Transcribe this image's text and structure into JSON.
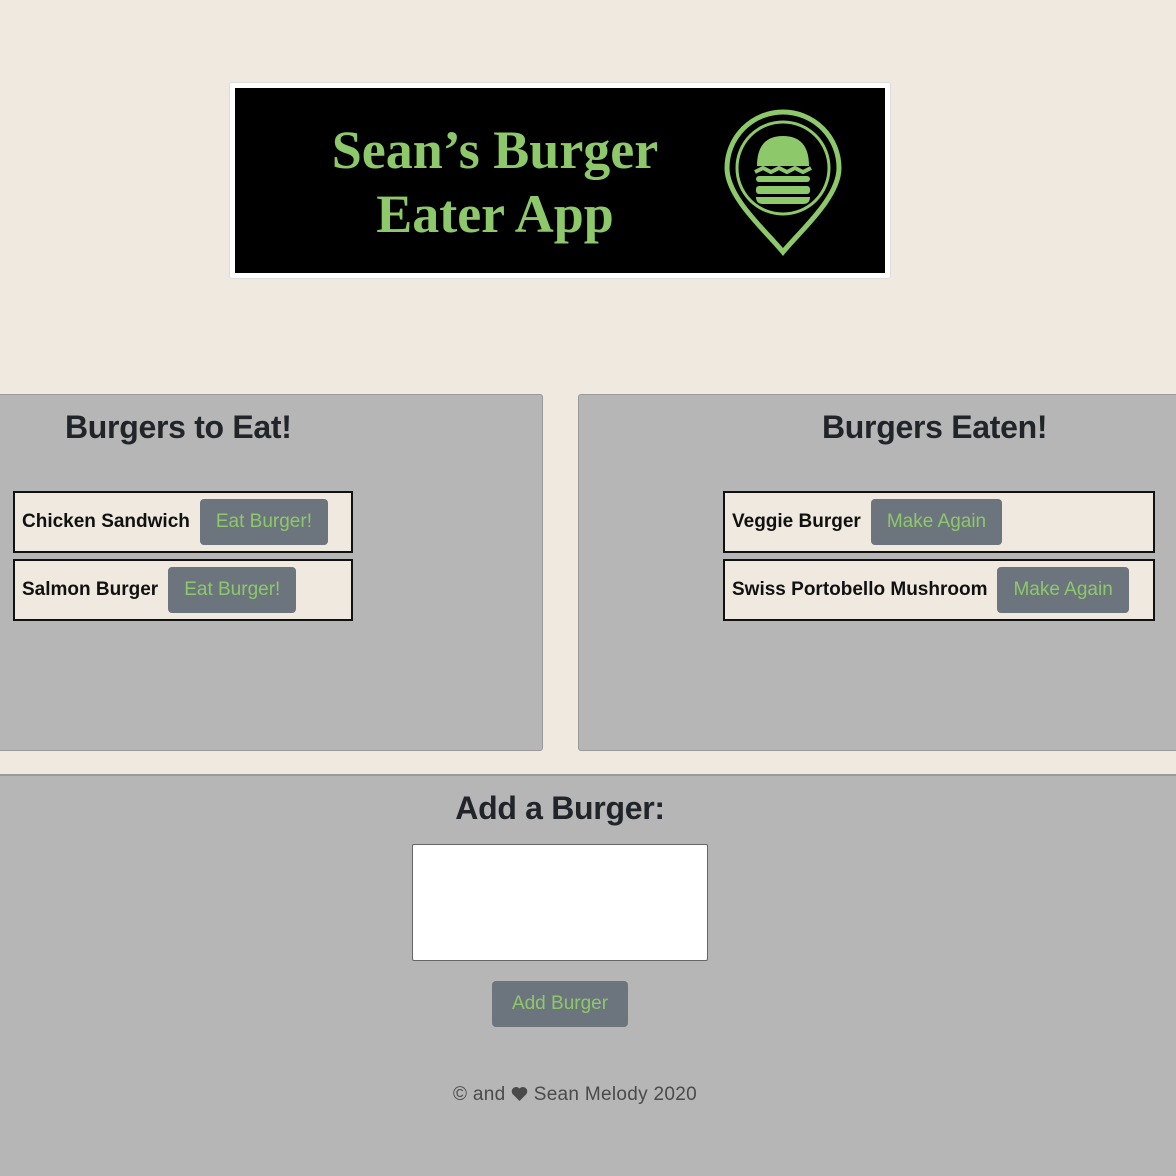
{
  "banner": {
    "title_line1": "Sean’s Burger",
    "title_line2": "Eater App",
    "logo_icon": "burger-location-pin-icon",
    "accent_color": "#8dc86a"
  },
  "to_eat": {
    "heading": "Burgers to Eat!",
    "items": [
      {
        "name": "Chicken Sandwich",
        "button": "Eat Burger!"
      },
      {
        "name": "Salmon Burger",
        "button": "Eat Burger!"
      }
    ]
  },
  "eaten": {
    "heading": "Burgers Eaten!",
    "items": [
      {
        "name": "Veggie Burger",
        "button": "Make Again"
      },
      {
        "name": "Swiss Portobello Mushroom",
        "button": "Make Again"
      }
    ]
  },
  "add": {
    "heading": "Add a Burger:",
    "input_value": "",
    "button": "Add Burger"
  },
  "footer": {
    "copyright_symbol": "©",
    "and_text": "and",
    "heart_icon": "heart-icon",
    "credit": "Sean Melody 2020"
  },
  "colors": {
    "background": "#f0e9e0",
    "panel": "#b6b6b6",
    "button_bg": "#6c757d",
    "button_text": "#8dc86a"
  }
}
